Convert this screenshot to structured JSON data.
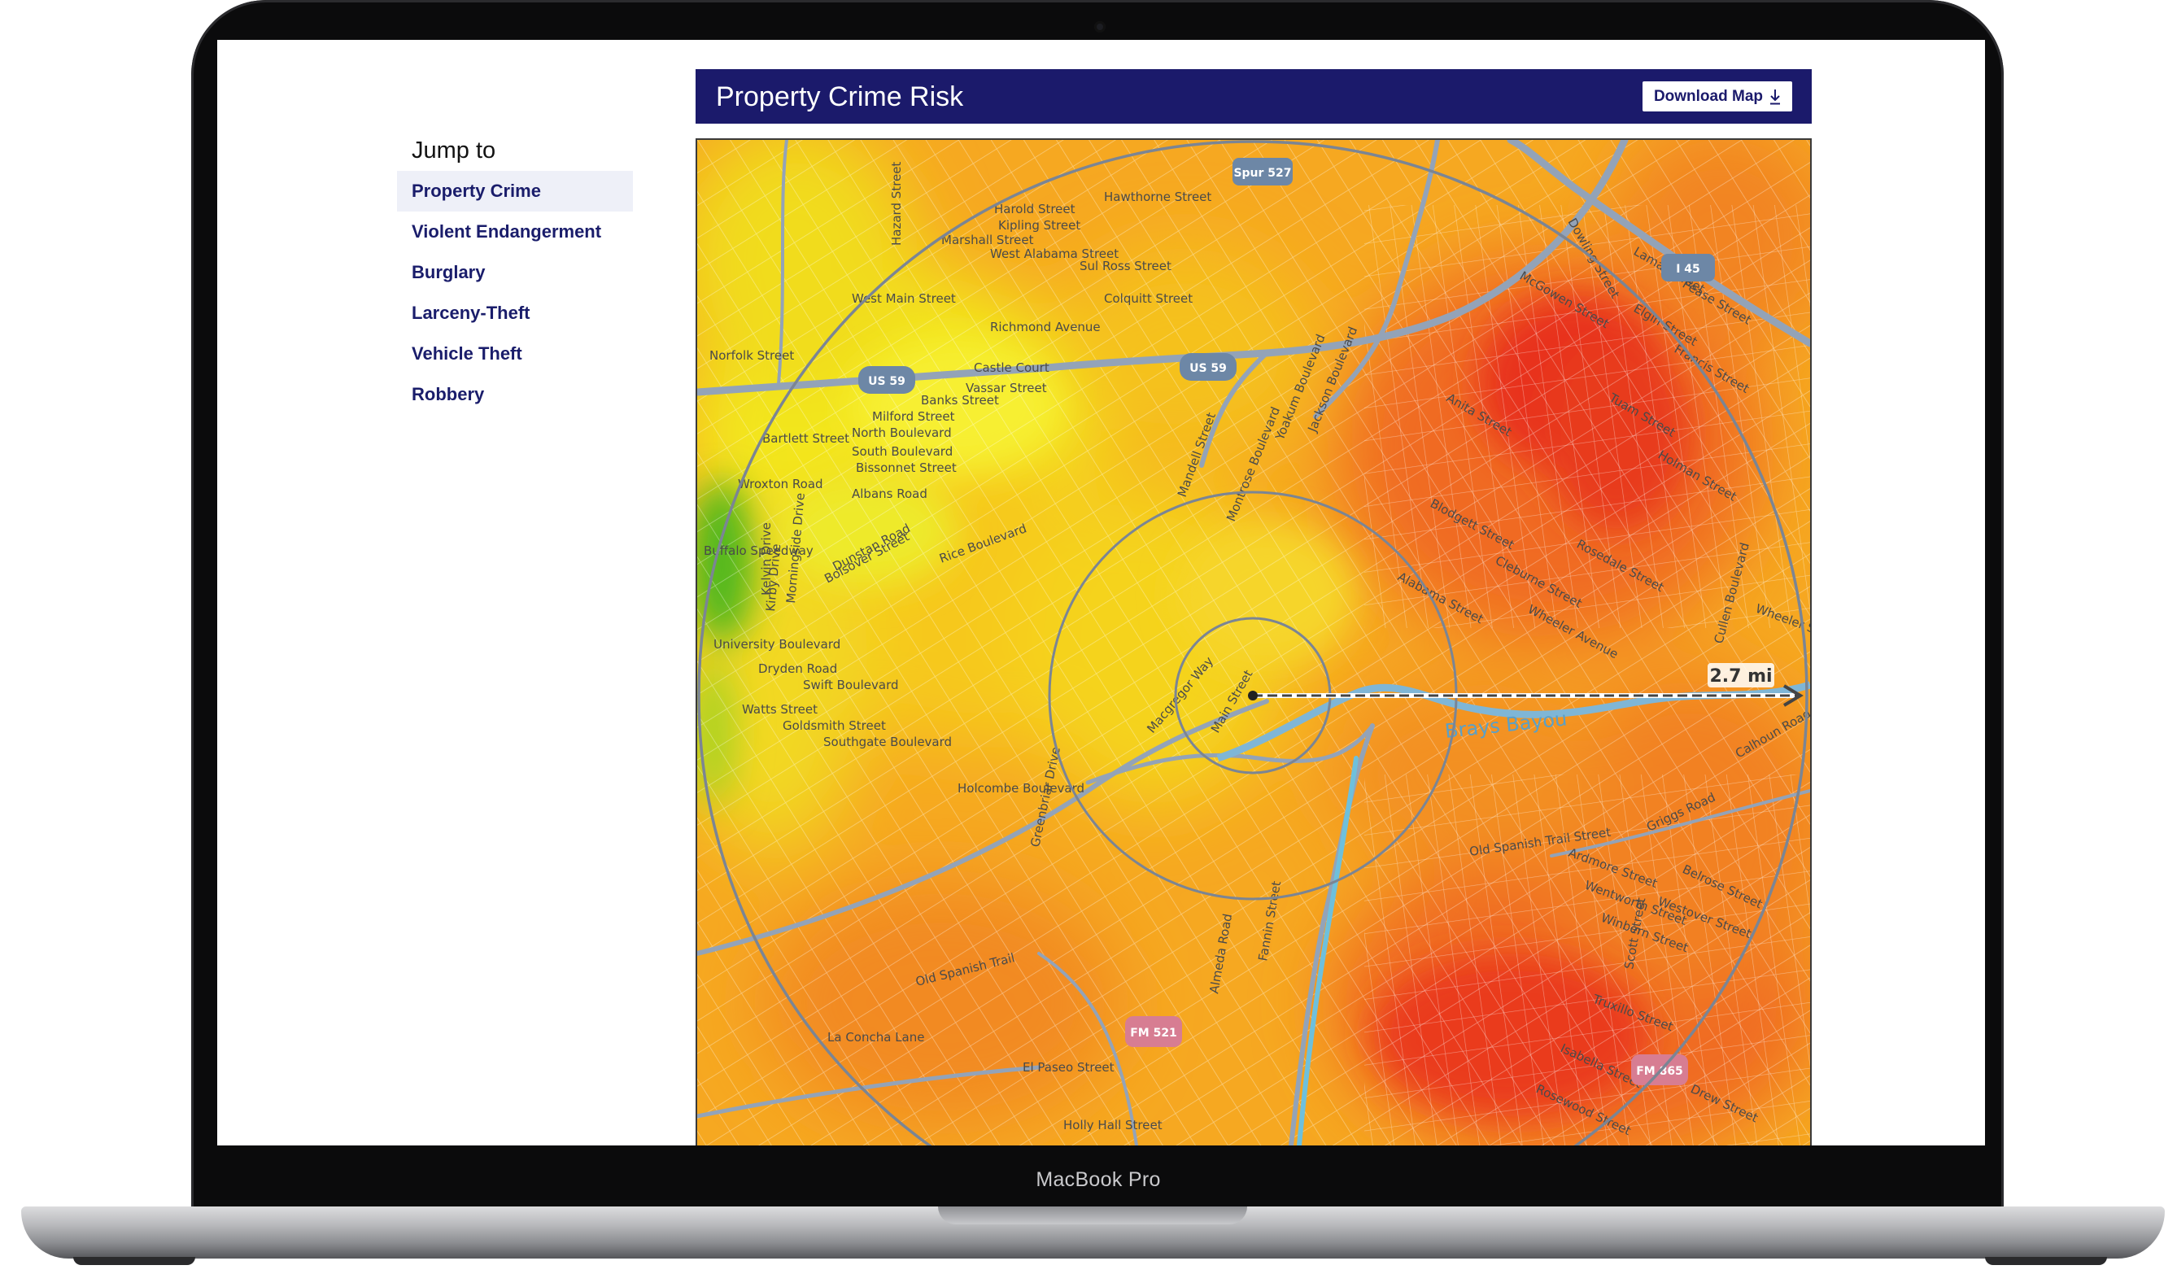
{
  "device": {
    "model_label": "MacBook Pro"
  },
  "nav": {
    "heading": "Jump to",
    "items": [
      {
        "label": "Property Crime",
        "active": true
      },
      {
        "label": "Violent Endangerment"
      },
      {
        "label": "Burglary"
      },
      {
        "label": "Larceny-Theft"
      },
      {
        "label": "Vehicle Theft"
      },
      {
        "label": "Robbery"
      }
    ]
  },
  "panel": {
    "title": "Property Crime Risk",
    "download_label": "Download Map",
    "download_icon": "download-arrow-icon"
  },
  "map": {
    "distance_label": "2.7 mi",
    "waterway_label": "Brays Bayou",
    "shields": [
      "Spur 527",
      "I 45",
      "US 59",
      "US 59",
      "FM 521",
      "FM 865"
    ],
    "street_labels": [
      "Hawthorne Street",
      "Harold Street",
      "Kipling Street",
      "Marshall Street",
      "West Alabama Street",
      "Sul Ross Street",
      "West Main Street",
      "Colquitt Street",
      "Richmond Avenue",
      "Castle Court",
      "Vassar Street",
      "Banks Street",
      "Milford Street",
      "North Boulevard",
      "South Boulevard",
      "Bissonnet Street",
      "Albans Road",
      "Dunstan Road",
      "Rice Boulevard",
      "University Boulevard",
      "Dryden Road",
      "Swift Boulevard",
      "Watts Street",
      "Goldsmith Street",
      "Southgate Boulevard",
      "Holcombe Boulevard",
      "Old Spanish Trail",
      "La Concha Lane",
      "El Paseo Street",
      "Holly Hall Street",
      "McGowen Street",
      "Tuam Street",
      "Elgin Street",
      "Wheeler Avenue",
      "Cleburne Street",
      "Rosedale Street",
      "Blodgett Street",
      "Alabama Street",
      "Lamar Street",
      "Anita Street",
      "Francis Street",
      "Dowling Street",
      "Pease Street",
      "Holman Street",
      "Isabella Street",
      "Drew Street",
      "Rosewood Street",
      "Winbern Street",
      "Truxillo Street",
      "Wentworth Street",
      "Westover Street",
      "Griggs Road",
      "Scott Street",
      "Cullen Boulevard",
      "Wheeler Street",
      "Old Spanish Trail Street",
      "Ardmore Street",
      "Belrose Street",
      "Calhoun Road",
      "Almeda Road",
      "Fannin Street",
      "Main Street",
      "Montrose Boulevard",
      "Mandell Street",
      "Yoakum Boulevard",
      "Jackson Boulevard",
      "Hazard Street",
      "Greenbriar Drive",
      "Kirby Drive",
      "Morningside Drive",
      "Kelvin Drive",
      "Buffalo Speedway",
      "Norfolk Street",
      "Bartlett Street",
      "Wroxton Road",
      "Bolsover Street",
      "Macgregor Way",
      "Spur 527"
    ]
  },
  "colors": {
    "header_bg": "#1b1a6b",
    "nav_text": "#1a1d6b",
    "nav_active_bg": "#eef0f8",
    "risk_low": "#4fb81c",
    "risk_medium_low": "#f3e81a",
    "risk_medium": "#f6a821",
    "risk_high": "#f05a22",
    "risk_very_high": "#e02020"
  }
}
